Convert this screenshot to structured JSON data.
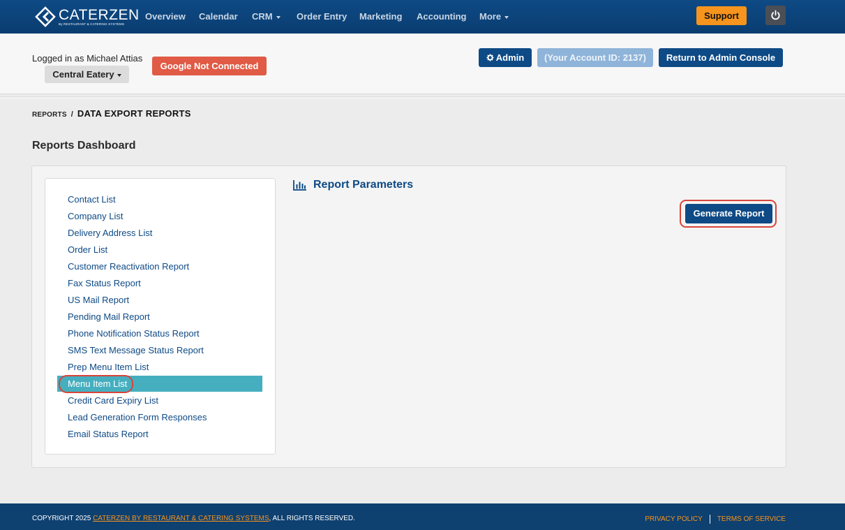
{
  "brand": {
    "name": "CATERZEN",
    "tagline": "By RESTAURANT & CATERING SYSTEMS"
  },
  "nav": {
    "items": [
      {
        "label": "Overview",
        "dropdown": false
      },
      {
        "label": "Calendar",
        "dropdown": false
      },
      {
        "label": "CRM",
        "dropdown": true
      },
      {
        "label": "Order Entry",
        "dropdown": false
      },
      {
        "label": "Marketing",
        "dropdown": false
      },
      {
        "label": "Accounting",
        "dropdown": false
      },
      {
        "label": "More",
        "dropdown": true
      }
    ],
    "support_label": "Support",
    "power_icon": "power-icon"
  },
  "header": {
    "logged_in_text": "Logged in as Michael Attias",
    "location_label": "Central Eatery",
    "google_status": "Google Not Connected",
    "admin_label": "Admin",
    "account_id_label": "(Your Account ID: 2137)",
    "return_label": "Return to Admin Console"
  },
  "breadcrumb": {
    "parent": "REPORTS",
    "separator": "/",
    "current": "DATA EXPORT REPORTS"
  },
  "page_title": "Reports Dashboard",
  "reports": [
    {
      "label": "Contact List",
      "active": false
    },
    {
      "label": "Company List",
      "active": false
    },
    {
      "label": "Delivery Address List",
      "active": false
    },
    {
      "label": "Order List",
      "active": false
    },
    {
      "label": "Customer Reactivation Report",
      "active": false
    },
    {
      "label": "Fax Status Report",
      "active": false
    },
    {
      "label": "US Mail Report",
      "active": false
    },
    {
      "label": "Pending Mail Report",
      "active": false
    },
    {
      "label": "Phone Notification Status Report",
      "active": false
    },
    {
      "label": "SMS Text Message Status Report",
      "active": false
    },
    {
      "label": "Prep Menu Item List",
      "active": false
    },
    {
      "label": "Menu Item List",
      "active": true
    },
    {
      "label": "Credit Card Expiry List",
      "active": false
    },
    {
      "label": "Lead Generation Form Responses",
      "active": false
    },
    {
      "label": "Email Status Report",
      "active": false
    }
  ],
  "params": {
    "title": "Report Parameters",
    "generate_label": "Generate Report",
    "icon": "bar-chart-icon"
  },
  "footer": {
    "copyright_prefix": "COPYRIGHT 2025 ",
    "company_link": "CATERZEN BY RESTAURANT & CATERING SYSTEMS",
    "copyright_suffix": ", ALL RIGHTS RESERVED.",
    "privacy_label": "PRIVACY POLICY",
    "terms_label": "TERMS OF SERVICE"
  },
  "colors": {
    "nav_bg": "#0e4a85",
    "accent_orange": "#f6941d",
    "danger_red": "#e05a45",
    "highlight_outline": "#d9443a",
    "active_row": "#45afbf",
    "link_blue": "#0e4a85"
  }
}
